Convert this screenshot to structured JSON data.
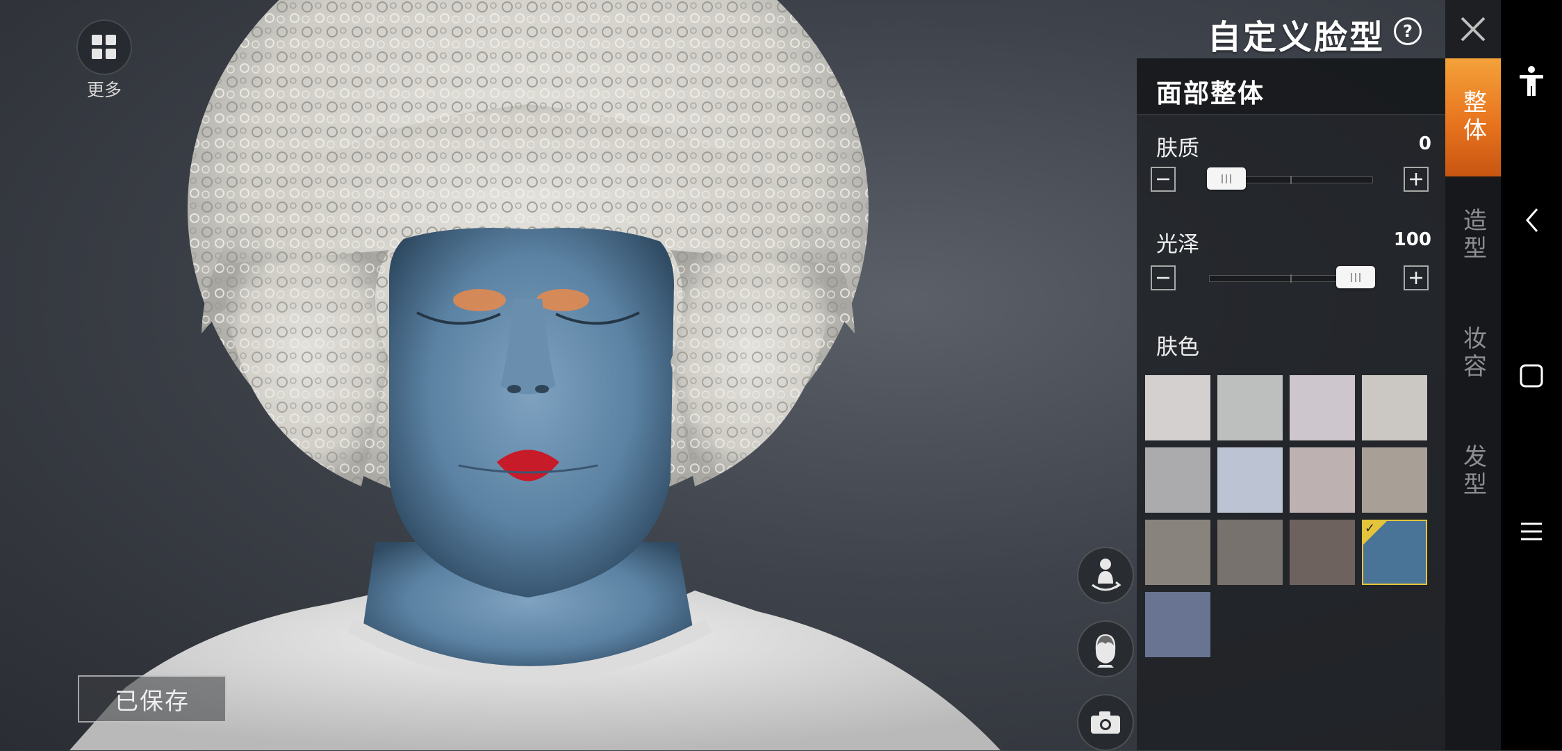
{
  "header": {
    "title": "自定义脸型",
    "help_symbol": "?"
  },
  "more": {
    "label": "更多"
  },
  "saved_button": {
    "label": "已保存"
  },
  "panel": {
    "section_title": "面部整体",
    "sliders": [
      {
        "label": "肤质",
        "value": "0",
        "fraction": 0.0
      },
      {
        "label": "光泽",
        "value": "100",
        "fraction": 1.0
      }
    ],
    "skin_color_label": "肤色",
    "swatches": [
      "#d3d0cf",
      "#bdbebe",
      "#cdc6cd",
      "#cbc8c4",
      "#ababae",
      "#bcc4d4",
      "#bdb2b1",
      "#a8a097",
      "#89837e",
      "#77726e",
      "#6e625f",
      "#4a7398",
      "#687491"
    ],
    "selected_swatch": 11
  },
  "tabs": [
    {
      "label": "整体",
      "active": true
    },
    {
      "label": "造型",
      "active": false
    },
    {
      "label": "妆容",
      "active": false
    },
    {
      "label": "发型",
      "active": false
    }
  ],
  "view_buttons": [
    "rotate-body-icon",
    "head-view-icon",
    "camera-icon"
  ],
  "colors": {
    "accent": "#e8741e",
    "selected_border": "#e4c43a",
    "skin": "#5f87a8"
  }
}
